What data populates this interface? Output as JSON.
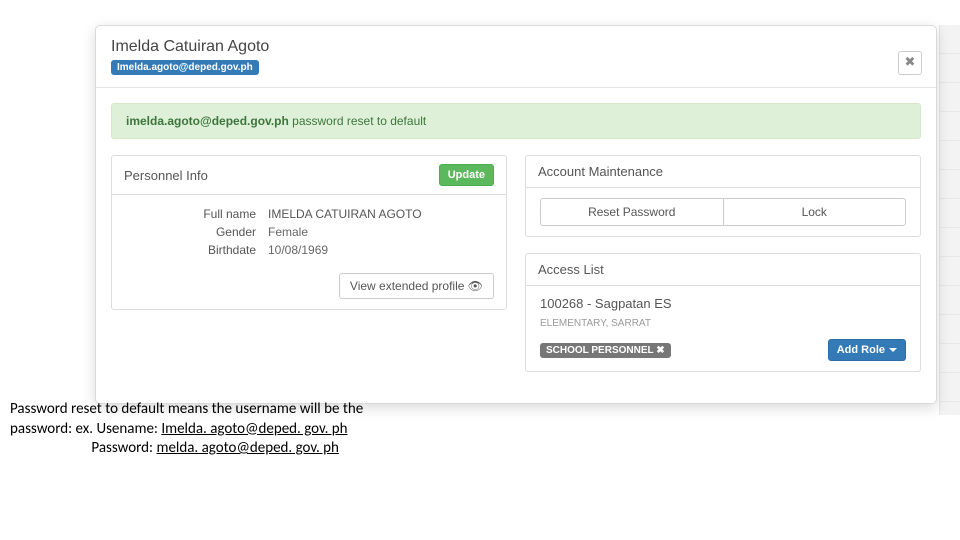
{
  "modal": {
    "title": "Imelda Catuiran Agoto",
    "email_tag": "Imelda.agoto@deped.gov.ph",
    "close": "✖"
  },
  "alert": {
    "email": "imelda.agoto@deped.gov.ph",
    "msg": " password reset to default"
  },
  "personnel": {
    "panel_title": "Personnel Info",
    "update": "Update",
    "fullname_label": "Full name",
    "fullname": "IMELDA CATUIRAN AGOTO",
    "gender_label": "Gender",
    "gender": "Female",
    "birthdate_label": "Birthdate",
    "birthdate": "10/08/1969",
    "view_ext": "View extended profile 👁"
  },
  "account": {
    "panel_title": "Account Maintenance",
    "reset": "Reset Password",
    "lock": "Lock"
  },
  "access": {
    "panel_title": "Access List",
    "school": "100268 - Sagpatan ES",
    "sub": "ELEMENTARY, SARRAT",
    "role_badge": "SCHOOL PERSONNEL ✖",
    "add_role": "Add Role"
  },
  "caption": {
    "l1a": "Password reset to default  means the username will be the ",
    "l2a": "password: ex. Usename: ",
    "l2u": "Imelda. agoto@deped. gov. ph",
    "l3a": "                        Password: ",
    "l3u": "melda. agoto@deped. gov. ph"
  }
}
